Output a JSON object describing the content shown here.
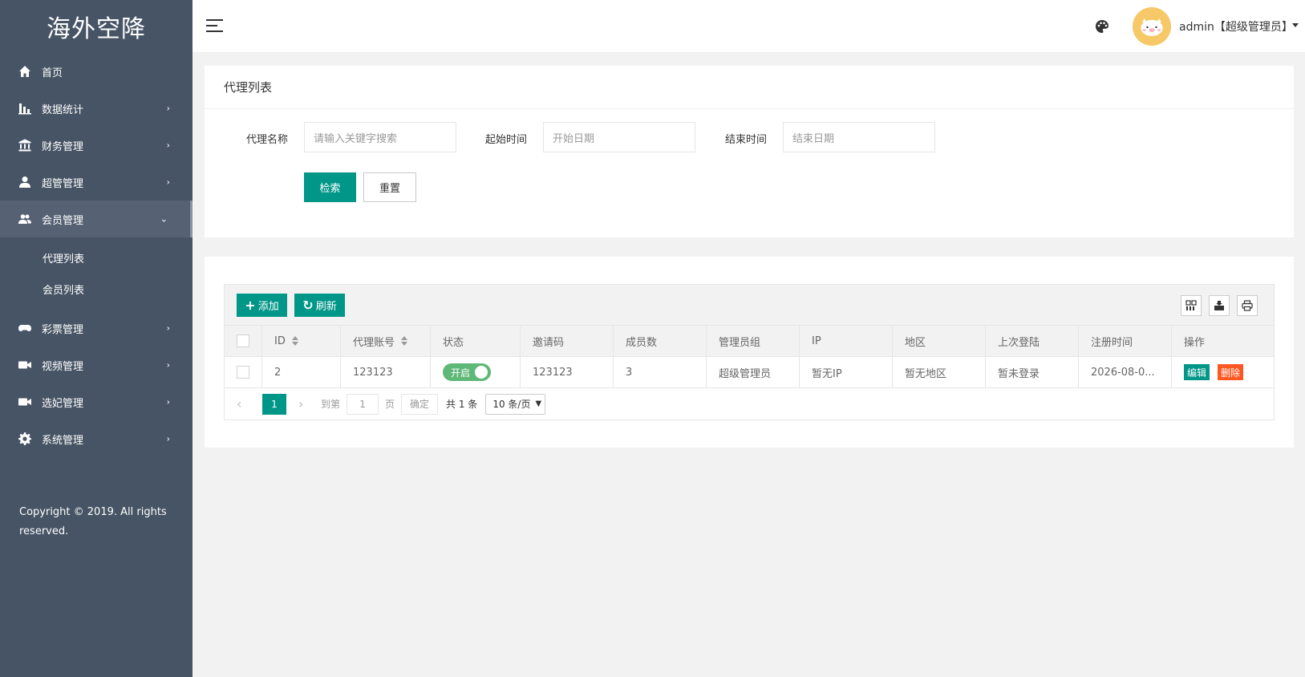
{
  "brand": {
    "title": "海外空降"
  },
  "sidebar": {
    "items": [
      {
        "label": "首页",
        "icon": "home-icon",
        "arrow": ""
      },
      {
        "label": "数据统计",
        "icon": "bar-chart-icon",
        "arrow": "›"
      },
      {
        "label": "财务管理",
        "icon": "bank-icon",
        "arrow": "›"
      },
      {
        "label": "超管管理",
        "icon": "user-icon",
        "arrow": "›"
      },
      {
        "label": "会员管理",
        "icon": "users-icon",
        "arrow": "⌄"
      },
      {
        "label": "彩票管理",
        "icon": "gamepad-icon",
        "arrow": "›"
      },
      {
        "label": "视频管理",
        "icon": "video-icon",
        "arrow": "›"
      },
      {
        "label": "选妃管理",
        "icon": "video-icon",
        "arrow": "›"
      },
      {
        "label": "系统管理",
        "icon": "gear-icon",
        "arrow": "›"
      }
    ],
    "sub_items": [
      "代理列表",
      "会员列表"
    ],
    "copyright": "Copyright © 2019. All rights reserved."
  },
  "header": {
    "user": "admin【超级管理员】",
    "avatar_color": "#f6c867"
  },
  "search_card": {
    "title": "代理列表",
    "name_label": "代理名称",
    "name_placeholder": "请输入关键字搜索",
    "start_label": "起始时间",
    "start_placeholder": "开始日期",
    "end_label": "结束时间",
    "end_placeholder": "结束日期",
    "search_btn": "检索",
    "reset_btn": "重置"
  },
  "table": {
    "add_btn": "添加",
    "refresh_btn": "刷新",
    "columns": [
      "ID",
      "代理账号",
      "状态",
      "邀请码",
      "成员数",
      "管理员组",
      "IP",
      "地区",
      "上次登陆",
      "注册时间",
      "操作"
    ],
    "rows": [
      {
        "id": "2",
        "account": "123123",
        "status": "开启",
        "invite_code": "123123",
        "members": "3",
        "group": "超级管理员",
        "ip": "暂无IP",
        "region": "暂无地区",
        "last_login": "暂未登录",
        "registered": "2026-08-0...",
        "edit": "编辑",
        "delete": "删除"
      }
    ]
  },
  "pager": {
    "current": "1",
    "goto_label": "到第",
    "goto_value": "1",
    "page_label": "页",
    "confirm": "确定",
    "total": "共 1 条",
    "page_size": "10 条/页"
  },
  "colors": {
    "accent": "#009688",
    "danger": "#ff5722",
    "sidebar": "#475465",
    "switch_on": "#5fb878"
  }
}
